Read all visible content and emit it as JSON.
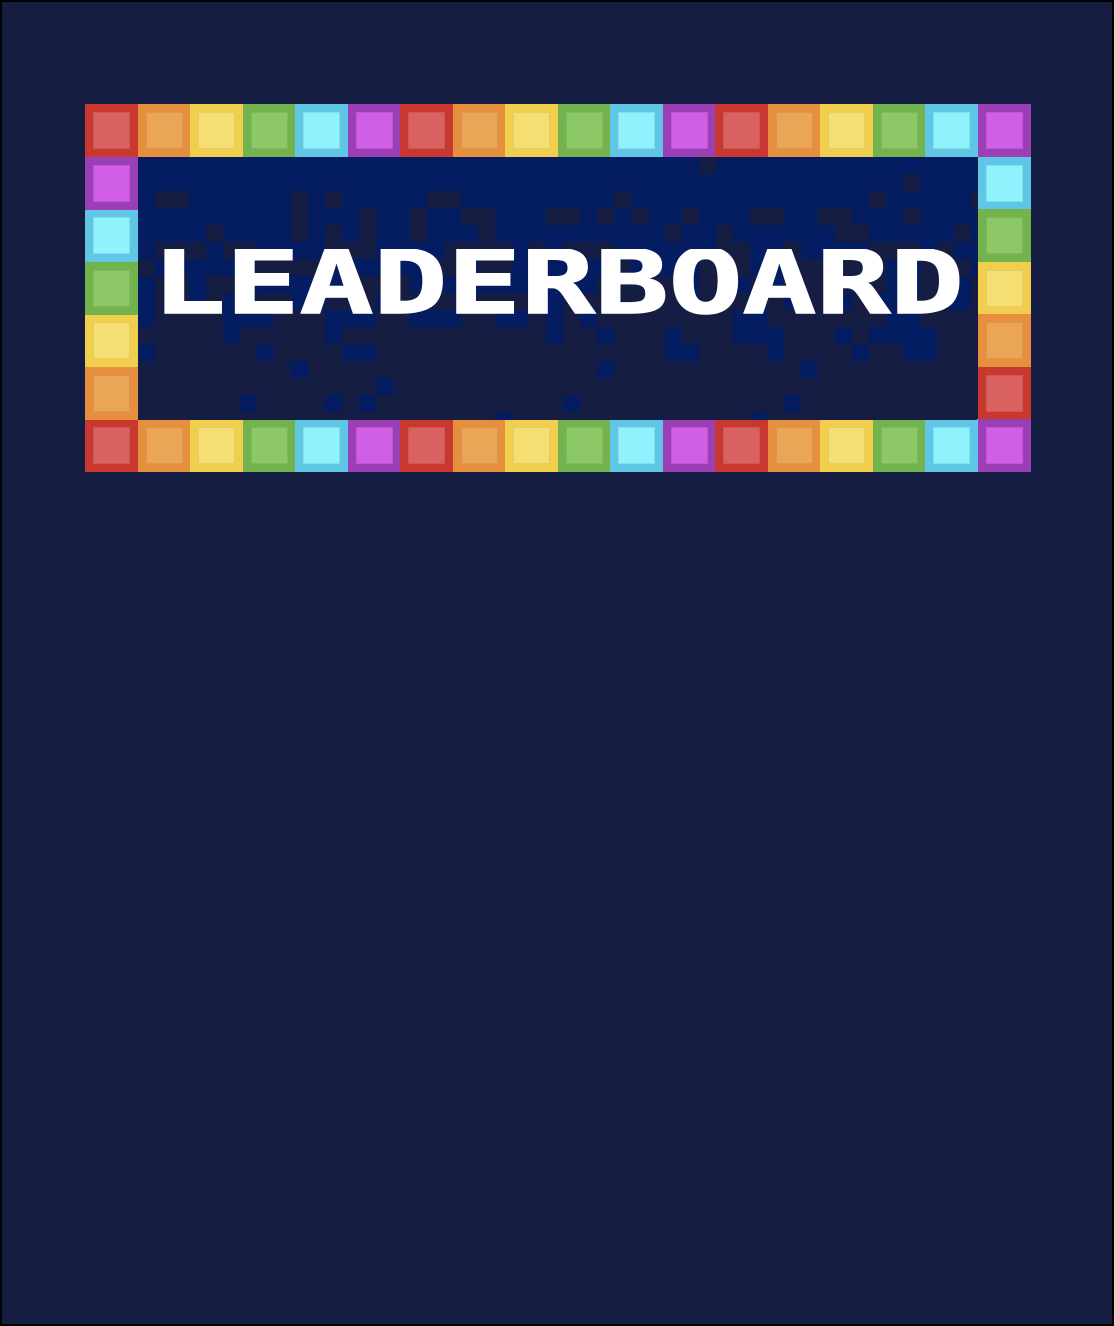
{
  "banner": {
    "title": "LEADERBOARD"
  },
  "palette": {
    "background": "#161d43",
    "panel_light": "#041c62",
    "panel_dark": "#161d43",
    "title_color": "#ffffff",
    "tiles": [
      {
        "name": "red",
        "outer": "#c9382f",
        "inner": "#d96160"
      },
      {
        "name": "orange",
        "outer": "#e58f3f",
        "inner": "#eaa557"
      },
      {
        "name": "yellow",
        "outer": "#f2ce4f",
        "inner": "#f6df72"
      },
      {
        "name": "green",
        "outer": "#73b34d",
        "inner": "#8dc866"
      },
      {
        "name": "cyan",
        "outer": "#5fc6e6",
        "inner": "#8ff2fd"
      },
      {
        "name": "purple",
        "outer": "#9b3fb6",
        "inner": "#d05fe6"
      }
    ]
  }
}
